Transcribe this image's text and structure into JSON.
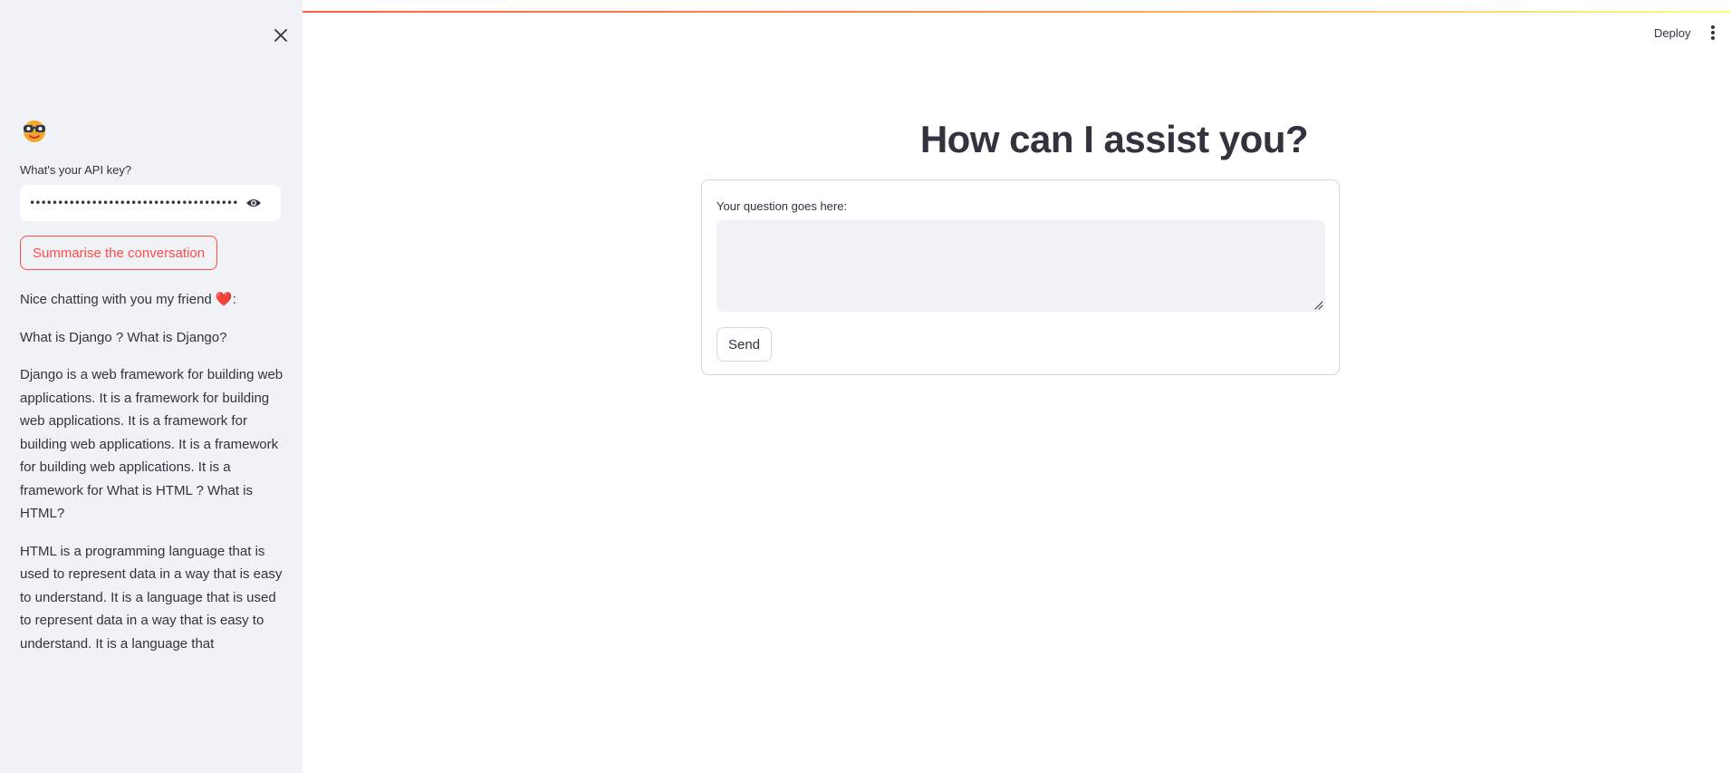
{
  "sidebar": {
    "api_key_label": "What's your API key?",
    "api_key_value": "••••••••••••••••••••••••••••••••••••••",
    "summarise_button": "Summarise the conversation",
    "greeting": "Nice chatting with you my friend ❤️:",
    "messages": [
      "What is Django ? What is Django?",
      "Django is a web framework for building web applications. It is a framework for building web applications. It is a framework for building web applications. It is a framework for building web applications. It is a framework for What is HTML ? What is HTML?",
      "HTML is a programming language that is used to represent data in a way that is easy to understand. It is a language that is used to represent data in a way that is easy to understand. It is a language that"
    ]
  },
  "header": {
    "deploy_label": "Deploy"
  },
  "main": {
    "title": "How can I assist you?",
    "question_label": "Your question goes here:",
    "question_value": "",
    "send_button": "Send"
  },
  "colors": {
    "accent": "#ff4b4b",
    "sidebar_bg": "#f0f2f6",
    "text": "#31333f"
  },
  "icons": [
    "close-icon",
    "avatar-emoji-icon",
    "eye-icon",
    "more-vertical-icon",
    "resize-grip-icon"
  ]
}
